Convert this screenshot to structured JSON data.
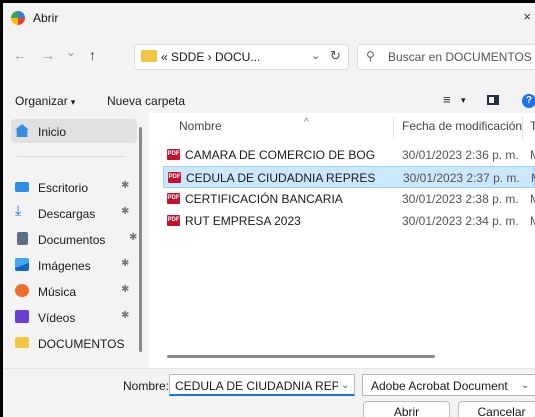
{
  "window": {
    "title": "Abrir",
    "close_glyph": "×"
  },
  "nav": {
    "back_glyph": "←",
    "forward_glyph": "→",
    "recent_glyph": "⌄",
    "up_glyph": "↑",
    "address_text": "« SDDE › DOCU...",
    "address_chevron": "⌄",
    "refresh_glyph": "↻",
    "search_placeholder": "Buscar en DOCUMENTOS RE...",
    "search_glyph": "⚲"
  },
  "toolbar": {
    "organizar_label": "Organizar",
    "organizar_caret": "▾",
    "nueva_carpeta_label": "Nueva carpeta",
    "view_glyph": "≡",
    "view_caret": "▾",
    "help_glyph": "?"
  },
  "sidebar": {
    "pin_glyph": "✱",
    "items": [
      {
        "label": "Inicio",
        "icon": "home-icon",
        "color": "#3a8de0"
      },
      {
        "label": "Escritorio",
        "icon": "desktop-icon",
        "color": "#2d8ee6"
      },
      {
        "label": "Descargas",
        "icon": "download-icon",
        "color": "#1a73e8"
      },
      {
        "label": "Documentos",
        "icon": "documents-icon",
        "color": "#5b6f85"
      },
      {
        "label": "Imágenes",
        "icon": "pictures-icon",
        "color": "#1e88e5"
      },
      {
        "label": "Música",
        "icon": "music-icon",
        "color": "#ef6c2f"
      },
      {
        "label": "Vídeos",
        "icon": "videos-icon",
        "color": "#6b3fd1"
      },
      {
        "label": "DOCUMENTOS",
        "icon": "folder-icon",
        "color": "#f4c542"
      }
    ]
  },
  "columns": {
    "name": "Nombre",
    "modified": "Fecha de modificación",
    "type": "Ti",
    "sort_glyph": "^"
  },
  "files": [
    {
      "name": "CAMARA DE COMERCIO DE BOGOTA",
      "modified": "30/01/2023 2:36 p. m.",
      "type": "M"
    },
    {
      "name": "CEDULA DE CIUDADNIA REPRESENTE LE...",
      "modified": "30/01/2023 2:37 p. m.",
      "type": "M"
    },
    {
      "name": "CERTIFICACIÓN BANCARIA",
      "modified": "30/01/2023 2:38 p. m.",
      "type": "M"
    },
    {
      "name": "RUT EMPRESA 2023",
      "modified": "30/01/2023 2:34 p. m.",
      "type": "M"
    }
  ],
  "file_icon_text": "PDF",
  "bottom": {
    "name_label": "Nombre:",
    "name_value": "CEDULA DE CIUDADNIA REPRESENT",
    "name_chevron": "⌄",
    "filetype_value": "Adobe Acrobat Document",
    "filetype_chevron": "⌄",
    "open_label": "Abrir",
    "cancel_label": "Cancelar"
  },
  "colors": {
    "accent": "#1a73e8",
    "selection_bg": "#cce8ff",
    "selection_border": "#99d1ff",
    "pdf_red": "#c8102e"
  }
}
